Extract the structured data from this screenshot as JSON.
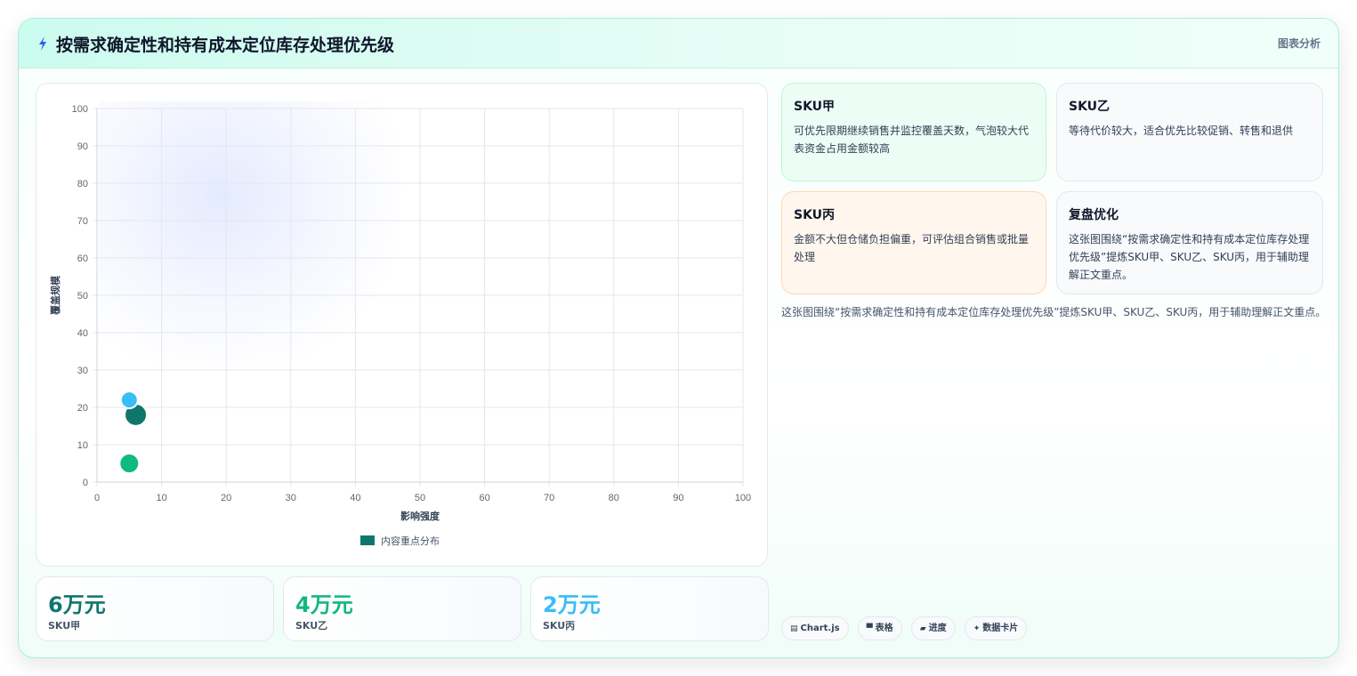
{
  "header": {
    "title": "按需求确定性和持有成本定位库存处理优先级",
    "tag": "图表分析",
    "icon": "lightning-icon"
  },
  "chart_data": {
    "type": "scatter",
    "xlabel": "影响强度",
    "ylabel": "覆盖规模",
    "xlim": [
      0,
      100
    ],
    "ylim": [
      0,
      100
    ],
    "xticks": [
      "0",
      "10",
      "20",
      "30",
      "40",
      "50",
      "60",
      "70",
      "80",
      "90",
      "100"
    ],
    "yticks": [
      "0",
      "10",
      "20",
      "30",
      "40",
      "50",
      "60",
      "70",
      "80",
      "90",
      "100"
    ],
    "grid": true,
    "legend": {
      "position": "bottom",
      "label": "内容重点分布"
    },
    "series": [
      {
        "name": "内容重点分布",
        "points": [
          {
            "x": 6,
            "y": 18,
            "r": 6,
            "color": "#0f766e"
          },
          {
            "x": 5,
            "y": 5,
            "r": 4,
            "color": "#10b981"
          },
          {
            "x": 5,
            "y": 22,
            "r": 2,
            "color": "#38bdf8"
          }
        ]
      }
    ]
  },
  "kpis": [
    {
      "value": "6万元",
      "label": "SKU甲",
      "color": "#0f766e"
    },
    {
      "value": "4万元",
      "label": "SKU乙",
      "color": "#10b981"
    },
    {
      "value": "2万元",
      "label": "SKU丙",
      "color": "#38bdf8"
    }
  ],
  "notes": [
    {
      "title": "SKU甲",
      "body": "可优先限期继续销售并监控覆盖天数，气泡较大代表资金占用金额较高"
    },
    {
      "title": "SKU乙",
      "body": "等待代价较大，适合优先比较促销、转售和退供"
    },
    {
      "title": "SKU丙",
      "body": "金额不大但仓储负担偏重，可评估组合销售或批量处理"
    },
    {
      "title": "复盘优化",
      "body": "这张图围绕“按需求确定性和持有成本定位库存处理优先级”提炼SKU甲、SKU乙、SKU丙，用于辅助理解正文重点。"
    }
  ],
  "caption": "这张图围绕“按需求确定性和持有成本定位库存处理优先级”提炼SKU甲、SKU乙、SKU丙，用于辅助理解正文重点。",
  "chips": [
    {
      "icon": "chart-icon",
      "glyph": "▤",
      "label": "Chart.js"
    },
    {
      "icon": "table-icon",
      "glyph": "▀",
      "label": "表格"
    },
    {
      "icon": "progress-icon",
      "glyph": "▰",
      "label": "进度"
    },
    {
      "icon": "sparkle-icon",
      "glyph": "✦",
      "label": "数据卡片"
    }
  ]
}
